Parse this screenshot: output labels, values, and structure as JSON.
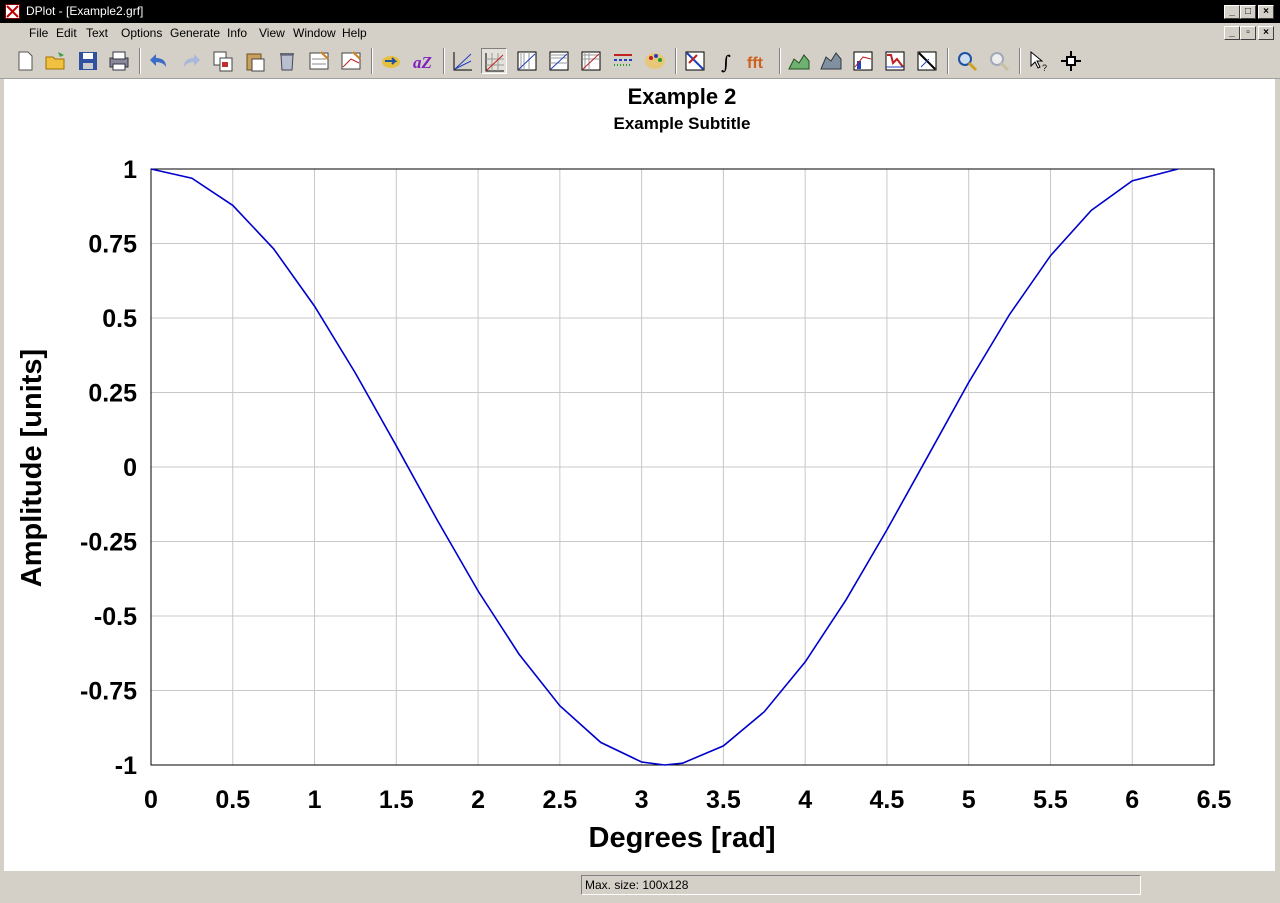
{
  "window": {
    "title": "DPlot - [Example2.grf]"
  },
  "menu": [
    "File",
    "Edit",
    "Text",
    "Options",
    "Generate",
    "Info",
    "View",
    "Window",
    "Help"
  ],
  "toolbar": {
    "buttons": [
      "new-file",
      "open-file",
      "save-file",
      "print",
      "undo",
      "redo",
      "copy-picture",
      "paste",
      "clear",
      "edit-data",
      "edit-curve",
      "import",
      "sort-az",
      "linear-scale",
      "grid",
      "semilog-x",
      "semilog-y",
      "log-log",
      "grid-lines",
      "colors",
      "delete-points",
      "integrate",
      "fft",
      "fill-area",
      "fill-between",
      "smooth",
      "plot-types",
      "rotate",
      "zoom-in",
      "zoom-out",
      "help-cursor",
      "crosshair"
    ],
    "integral_glyph": "∫",
    "fft_label": "fft",
    "az_label": "aZ"
  },
  "chart_data": {
    "type": "line",
    "title": "Example 2",
    "subtitle": "Example Subtitle",
    "xlabel": "Degrees [rad]",
    "ylabel": "Amplitude [units]",
    "xlim": [
      0,
      6.5
    ],
    "ylim": [
      -1,
      1
    ],
    "xticks": [
      "0",
      "0.5",
      "1",
      "1.5",
      "2",
      "2.5",
      "3",
      "3.5",
      "4",
      "4.5",
      "5",
      "5.5",
      "6",
      "6.5"
    ],
    "yticks": [
      "1",
      "0.75",
      "0.5",
      "0.25",
      "0",
      "-0.25",
      "-0.5",
      "-0.75",
      "-1"
    ],
    "grid": true,
    "series": [
      {
        "color": "#0000cc",
        "x": [
          0,
          0.25,
          0.5,
          0.75,
          1,
          1.25,
          1.5,
          1.75,
          2,
          2.25,
          2.5,
          2.75,
          3,
          3.14,
          3.25,
          3.5,
          3.75,
          4,
          4.25,
          4.5,
          4.75,
          5,
          5.25,
          5.5,
          5.75,
          6,
          6.28
        ],
        "y": [
          1,
          0.969,
          0.878,
          0.732,
          0.54,
          0.315,
          0.071,
          -0.178,
          -0.416,
          -0.628,
          -0.801,
          -0.924,
          -0.99,
          -1,
          -0.994,
          -0.936,
          -0.821,
          -0.654,
          -0.446,
          -0.211,
          0.036,
          0.284,
          0.512,
          0.709,
          0.861,
          0.96,
          1
        ]
      }
    ]
  },
  "status": {
    "text": "Max. size: 100x128"
  }
}
